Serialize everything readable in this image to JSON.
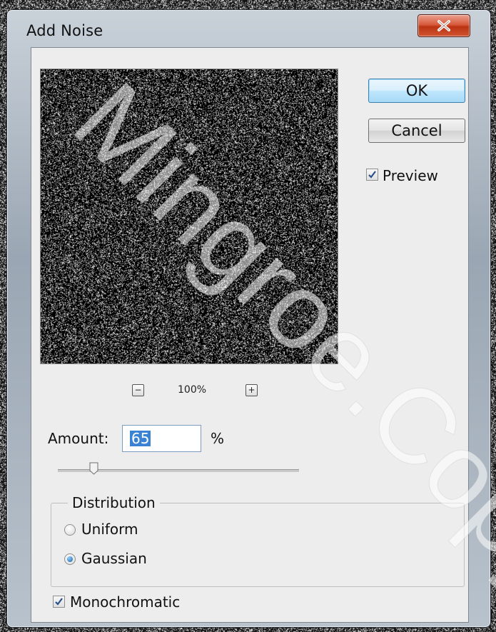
{
  "window": {
    "title": "Add Noise",
    "close_icon": "close-icon"
  },
  "buttons": {
    "ok": "OK",
    "cancel": "Cancel"
  },
  "preview_checkbox": {
    "label": "Preview",
    "checked": true
  },
  "zoom": {
    "level": "100%",
    "minus_icon": "zoom-out-icon",
    "plus_icon": "zoom-in-icon"
  },
  "amount": {
    "label": "Amount:",
    "value": "65",
    "unit": "%",
    "slider_fraction": 0.13
  },
  "distribution": {
    "title": "Distribution",
    "options": [
      {
        "label": "Uniform",
        "selected": false
      },
      {
        "label": "Gaussian",
        "selected": true
      }
    ]
  },
  "monochromatic": {
    "label": "Monochromatic",
    "checked": true
  },
  "watermark": "Mingroe.Copy",
  "colors": {
    "accent": "#3a83d4",
    "close_button": "#c8432a",
    "dialog_bg": "#ededed"
  }
}
